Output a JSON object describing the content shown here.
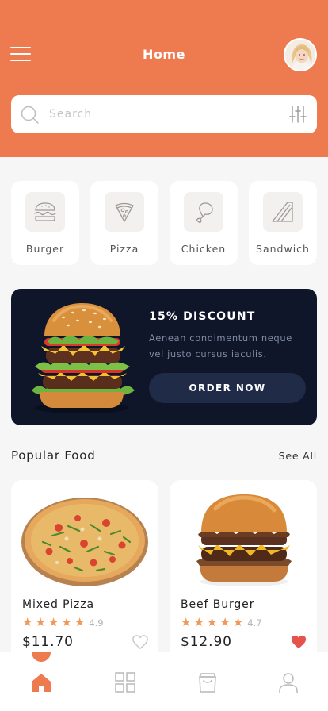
{
  "header": {
    "title": "Home",
    "menu_icon": "hamburger-menu-icon",
    "avatar_icon": "user-avatar"
  },
  "search": {
    "placeholder": "Search",
    "value": "",
    "search_icon": "search-icon",
    "filter_icon": "sliders-icon"
  },
  "categories": [
    {
      "label": "Burger",
      "icon": "burger-icon"
    },
    {
      "label": "Pizza",
      "icon": "pizza-slice-icon"
    },
    {
      "label": "Chicken",
      "icon": "chicken-leg-icon"
    },
    {
      "label": "Sandwich",
      "icon": "sandwich-icon"
    }
  ],
  "promo": {
    "title": "15% DISCOUNT",
    "description": "Aenean condimentum neque vel justo cursus iaculis.",
    "button_label": "ORDER NOW"
  },
  "popular": {
    "section_title": "Popular Food",
    "see_all_label": "See All",
    "items": [
      {
        "name": "Mixed Pizza",
        "rating": "4.9",
        "price": "$11.70",
        "favorite": false
      },
      {
        "name": "Beef Burger",
        "rating": "4.7",
        "price": "$12.90",
        "favorite": true
      }
    ]
  },
  "bottom_nav": {
    "items": [
      {
        "icon": "home-icon",
        "active": true
      },
      {
        "icon": "grid-icon",
        "active": false
      },
      {
        "icon": "shopping-bag-icon",
        "active": false
      },
      {
        "icon": "profile-icon",
        "active": false
      }
    ]
  },
  "colors": {
    "accent": "#ee7a4f",
    "promo_bg": "#0f1629",
    "star": "#ee9a5b",
    "heart_active": "#e5534b"
  }
}
